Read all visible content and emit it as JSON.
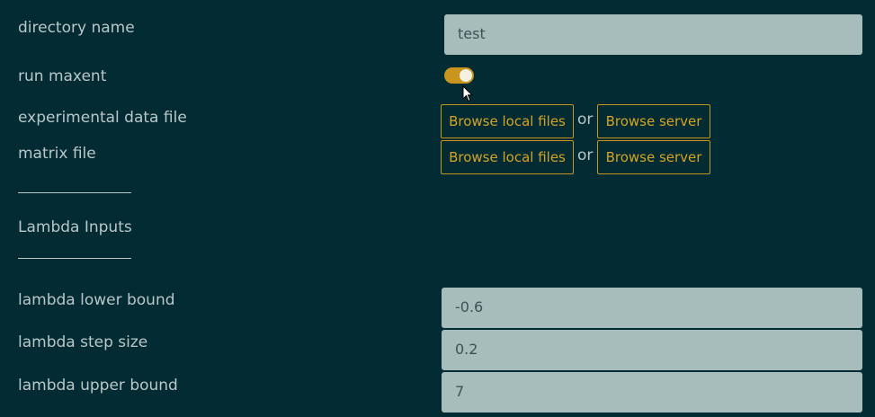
{
  "form": {
    "directory_name": {
      "label": "directory name",
      "value": "test"
    },
    "run_maxent": {
      "label": "run maxent",
      "enabled": true
    },
    "experimental_data_file": {
      "label": "experimental data file",
      "browse_local_label": "Browse local files",
      "or_label": "or",
      "browse_server_label": "Browse server"
    },
    "matrix_file": {
      "label": "matrix file",
      "browse_local_label": "Browse local files",
      "or_label": "or",
      "browse_server_label": "Browse server"
    },
    "lambda_section": {
      "title": "Lambda Inputs"
    },
    "lambda_lower_bound": {
      "label": "lambda lower bound",
      "value": "-0.6"
    },
    "lambda_step_size": {
      "label": "lambda step size",
      "value": "0.2"
    },
    "lambda_upper_bound": {
      "label": "lambda upper bound",
      "value": "7"
    }
  },
  "colors": {
    "background": "#022b33",
    "accent": "#c8961c",
    "field_background": "#a7bdbb",
    "label_text": "#b9c7c8"
  },
  "icons": {
    "cursor": "mouse-pointer-icon"
  }
}
